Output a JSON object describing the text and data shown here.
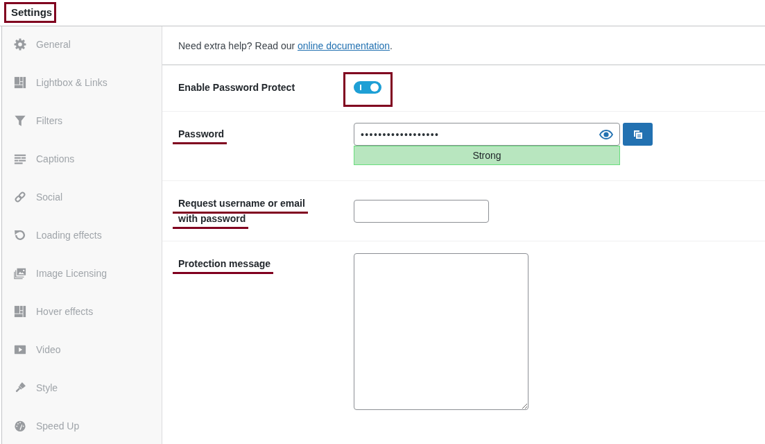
{
  "header": {
    "title": "Settings",
    "marked": true
  },
  "sidebar": {
    "items": [
      {
        "label": "General",
        "selected": false
      },
      {
        "label": "Lightbox & Links",
        "selected": false
      },
      {
        "label": "Filters",
        "selected": false
      },
      {
        "label": "Captions",
        "selected": false
      },
      {
        "label": "Social",
        "selected": false
      },
      {
        "label": "Loading effects",
        "selected": false
      },
      {
        "label": "Image Licensing",
        "selected": false
      },
      {
        "label": "Hover effects",
        "selected": false
      },
      {
        "label": "Video",
        "selected": false
      },
      {
        "label": "Style",
        "selected": false
      },
      {
        "label": "Speed Up",
        "selected": false
      }
    ]
  },
  "help": {
    "text": "Need extra help? Read our ",
    "link": "online documentation",
    "after": "."
  },
  "fields": [
    {
      "kind": "toggle",
      "label": "Enable Password Protect",
      "on": true,
      "label_marked": false,
      "control_marked": true
    },
    {
      "kind": "password",
      "label": "Password",
      "value": "••••••••••••••••••",
      "strength": "Strong",
      "label_marked": true,
      "control_marked": false
    },
    {
      "kind": "text",
      "label": "Request username or email with password",
      "label_marked": true,
      "control_marked": false
    },
    {
      "kind": "textarea",
      "label": "Protection message",
      "label_marked": true,
      "control_marked": false
    }
  ]
}
